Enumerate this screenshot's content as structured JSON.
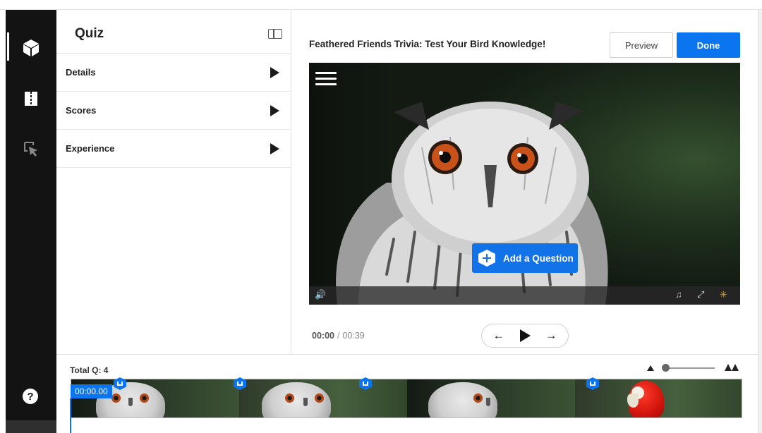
{
  "rail": {
    "items": [
      {
        "icon": "cube-icon"
      },
      {
        "icon": "chapters-icon"
      },
      {
        "icon": "pointer-icon"
      }
    ],
    "help_label": "?"
  },
  "panel": {
    "title": "Quiz",
    "sections": [
      {
        "label": "Details"
      },
      {
        "label": "Scores"
      },
      {
        "label": "Experience"
      }
    ]
  },
  "header": {
    "quiz_title": "Feathered Friends Trivia: Test Your Bird Knowledge!",
    "preview_label": "Preview",
    "done_label": "Done"
  },
  "video": {
    "add_question_label": "Add a Question"
  },
  "playback": {
    "current": "00:00",
    "separator": "/",
    "duration": "00:39"
  },
  "timeline": {
    "total_questions": "Total Q: 4",
    "playhead_time": "00:00.00",
    "question_markers": 4,
    "zoom_level": 0.0
  },
  "colors": {
    "accent": "#0b74ef",
    "rail": "#131313"
  }
}
